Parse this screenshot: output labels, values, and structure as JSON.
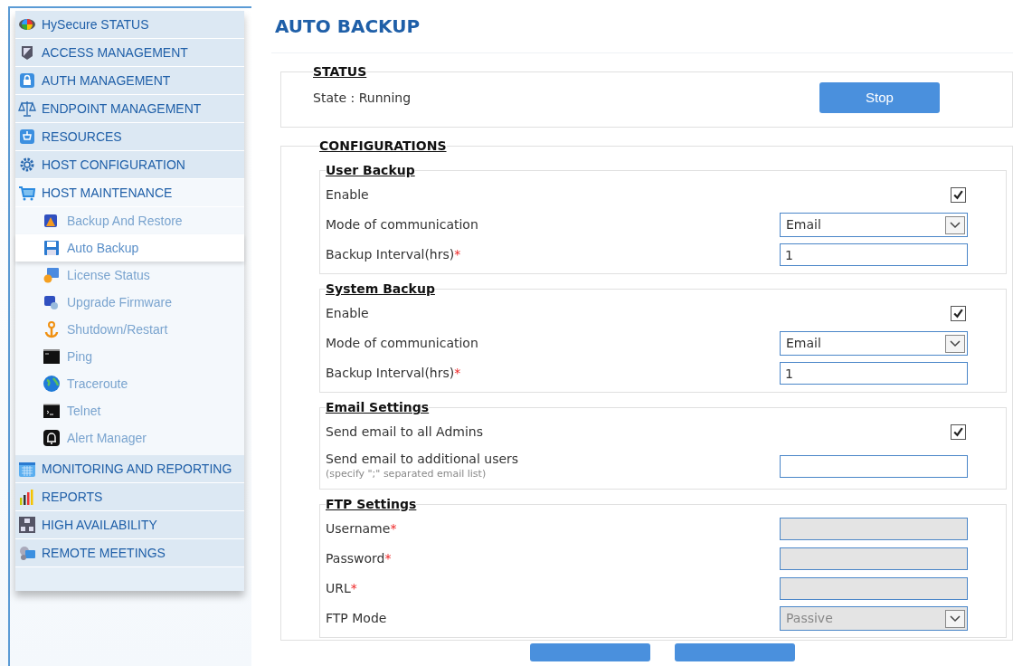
{
  "sidebar": {
    "items": [
      {
        "label": "HySecure STATUS",
        "selected": false
      },
      {
        "label": "ACCESS MANAGEMENT",
        "selected": false
      },
      {
        "label": "AUTH MANAGEMENT",
        "selected": false
      },
      {
        "label": "ENDPOINT MANAGEMENT",
        "selected": false
      },
      {
        "label": "RESOURCES",
        "selected": false
      },
      {
        "label": "HOST CONFIGURATION",
        "selected": false
      },
      {
        "label": "HOST MAINTENANCE",
        "selected": true,
        "children": [
          {
            "label": "Backup And Restore",
            "selected": false
          },
          {
            "label": "Auto Backup",
            "selected": true
          },
          {
            "label": "License Status",
            "selected": false
          },
          {
            "label": "Upgrade Firmware",
            "selected": false
          },
          {
            "label": "Shutdown/Restart",
            "selected": false
          },
          {
            "label": "Ping",
            "selected": false
          },
          {
            "label": "Traceroute",
            "selected": false
          },
          {
            "label": "Telnet",
            "selected": false
          },
          {
            "label": "Alert Manager",
            "selected": false
          }
        ]
      },
      {
        "label": "MONITORING AND REPORTING",
        "selected": false
      },
      {
        "label": "REPORTS",
        "selected": false
      },
      {
        "label": "HIGH AVAILABILITY",
        "selected": false
      },
      {
        "label": "REMOTE MEETINGS",
        "selected": false
      }
    ]
  },
  "page_title": "AUTO BACKUP",
  "status": {
    "legend": "STATUS",
    "state": "State : Running",
    "button": "Stop"
  },
  "configurations": {
    "legend": "CONFIGURATIONS",
    "groups": [
      {
        "legend": "User Backup",
        "rows": [
          {
            "kind": "checkbox",
            "label": "Enable",
            "checked": true
          },
          {
            "kind": "select",
            "label": "Mode of communication",
            "value": "Email",
            "disabled": false
          },
          {
            "kind": "input",
            "label": "Backup Interval(hrs)",
            "required_mark": "*",
            "value": "1",
            "disabled": false
          }
        ]
      },
      {
        "legend": "System Backup",
        "rows": [
          {
            "kind": "checkbox",
            "label": "Enable",
            "checked": true
          },
          {
            "kind": "select",
            "label": "Mode of communication",
            "value": "Email",
            "disabled": false
          },
          {
            "kind": "input",
            "label": "Backup Interval(hrs)",
            "required_mark": "*",
            "value": "1",
            "disabled": false
          }
        ]
      },
      {
        "legend": "Email Settings",
        "rows": [
          {
            "kind": "checkbox",
            "label": "Send email to all Admins",
            "checked": true
          },
          {
            "kind": "input",
            "label": "Send email to additional users",
            "hint": "(specify \";\" separated email list)",
            "value": "",
            "disabled": false
          }
        ]
      },
      {
        "legend": "FTP Settings",
        "rows": [
          {
            "kind": "input",
            "label": "Username",
            "required_mark": "*",
            "value": "",
            "disabled": true
          },
          {
            "kind": "input",
            "label": "Password",
            "required_mark": "*",
            "value": "",
            "disabled": true
          },
          {
            "kind": "input",
            "label": "URL",
            "required_mark": "*",
            "value": "",
            "disabled": true
          },
          {
            "kind": "select",
            "label": "FTP Mode",
            "value": "Passive",
            "disabled": true
          }
        ]
      }
    ]
  }
}
